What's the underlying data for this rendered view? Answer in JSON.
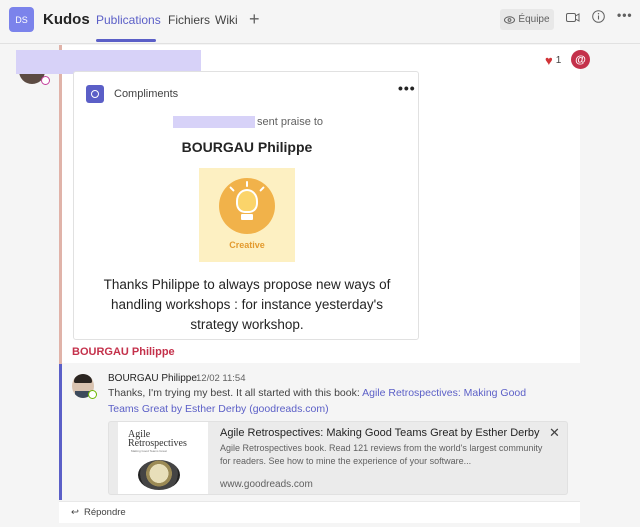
{
  "header": {
    "team_initials": "DS",
    "team_name": "Kudos",
    "tabs": [
      {
        "label": "Publications",
        "active": true
      },
      {
        "label": "Fichiers",
        "active": false
      },
      {
        "label": "Wiki",
        "active": false
      }
    ],
    "add_tab_icon": "plus-icon",
    "team_button_label": "Équipe"
  },
  "post": {
    "reaction_count": "1",
    "mention_symbol": "@",
    "card": {
      "label": "Compliments",
      "more_symbol": "•••",
      "sent_text": "sent praise to",
      "recipient": "BOURGAU Philippe",
      "badge_label": "Creative",
      "message": "Thanks Philippe to always propose new ways of handling workshops : for instance yesterday's strategy workshop."
    }
  },
  "reply": {
    "label_name": "BOURGAU Philippe",
    "author": "BOURGAU Philippe",
    "time": "12/02 11:54",
    "text_before": "Thanks, I'm trying my best. It all started with this book: ",
    "link_text": "Agile Retrospectives: Making Good Teams Great by Esther Derby (goodreads.com)",
    "preview": {
      "thumb_title": "Agile Retrospectives",
      "thumb_subtitle": "Making Good Teams Great",
      "title": "Agile Retrospectives: Making Good Teams Great by Esther Derby",
      "description": "Agile Retrospectives book. Read 121 reviews from the world's largest community for readers. See how to mine the experience of your software...",
      "url": "www.goodreads.com",
      "close_symbol": "✕"
    },
    "reply_button_label": "Répondre"
  },
  "colors": {
    "brand": "#5b5fc7",
    "accent_red": "#c4314b",
    "badge_orange": "#f1b24a"
  }
}
